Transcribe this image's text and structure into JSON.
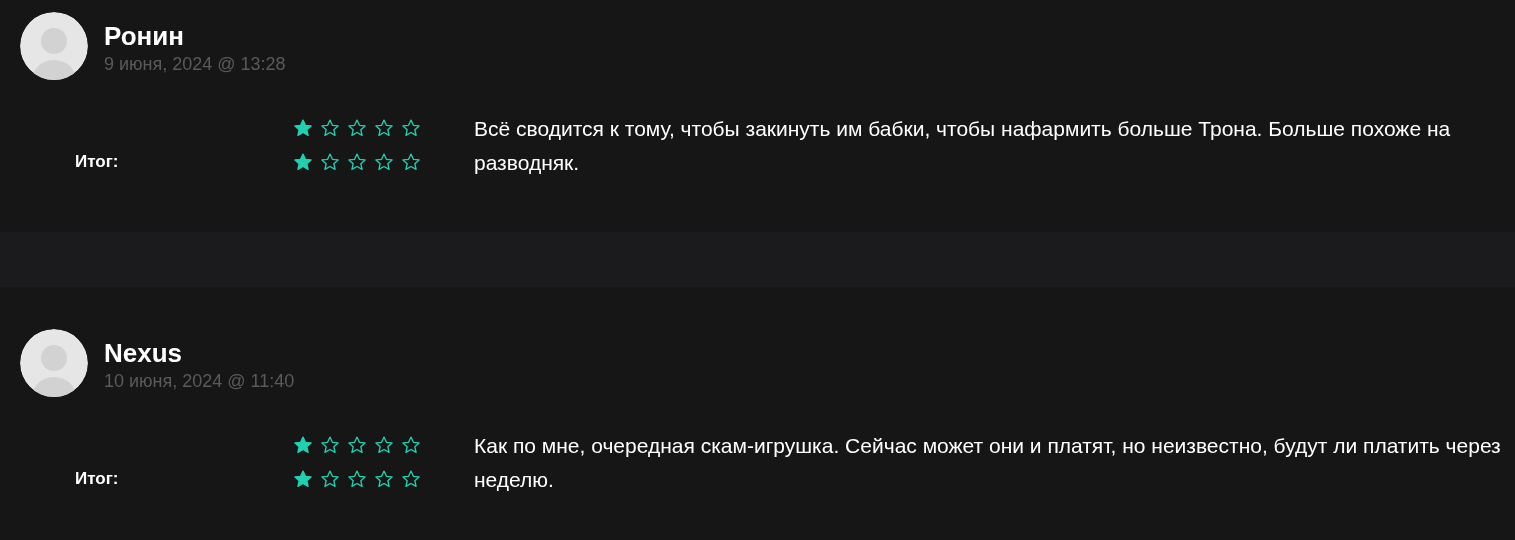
{
  "reviews": [
    {
      "author": "Ронин",
      "date": "9 июня, 2024 @ 13:28",
      "ratings": [
        {
          "stars": 1
        },
        {
          "label": "Итог:",
          "stars": 1
        }
      ],
      "text": "Всё сводится к тому, чтобы закинуть им бабки, чтобы нафармить больше Трона. Больше похоже на разводняк."
    },
    {
      "author": "Nexus",
      "date": "10 июня, 2024 @ 11:40",
      "ratings": [
        {
          "stars": 1
        },
        {
          "label": "Итог:",
          "stars": 1
        }
      ],
      "text": "Как по мне, очередная скам-игрушка. Сейчас может они и платят, но неизвестно, будут ли платить через неделю."
    }
  ]
}
